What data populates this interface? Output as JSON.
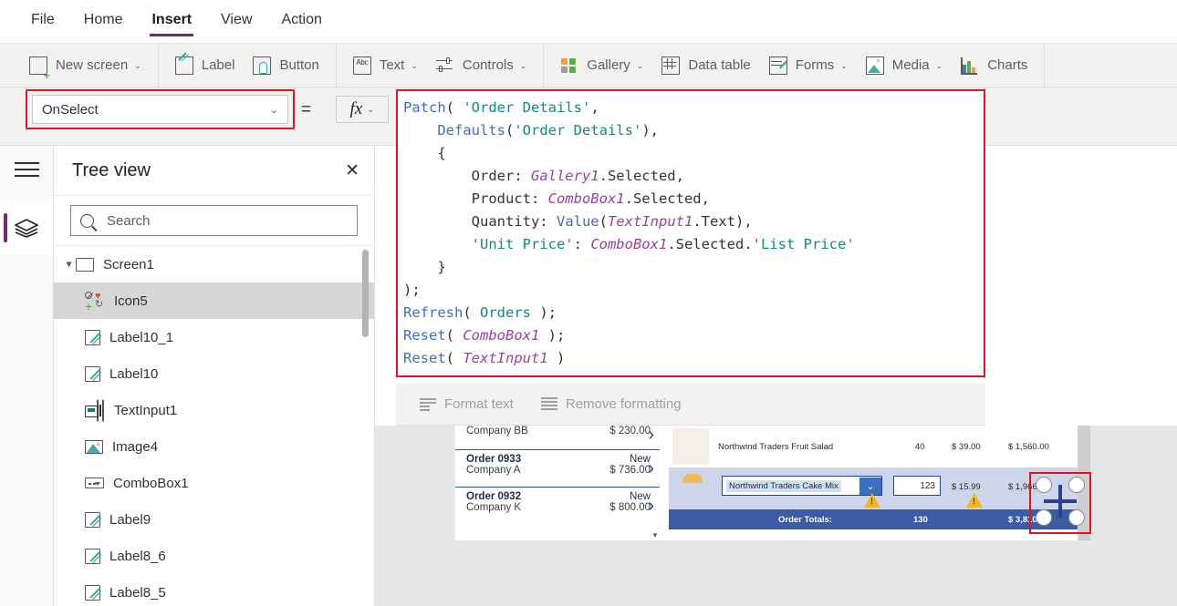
{
  "menu": {
    "items": [
      {
        "label": "File",
        "active": false
      },
      {
        "label": "Home",
        "active": false
      },
      {
        "label": "Insert",
        "active": true
      },
      {
        "label": "View",
        "active": false
      },
      {
        "label": "Action",
        "active": false
      }
    ]
  },
  "ribbon": {
    "groups": [
      {
        "buttons": [
          {
            "label": "New screen",
            "icon": "new-screen-icon",
            "chevron": true
          }
        ]
      },
      {
        "buttons": [
          {
            "label": "Label",
            "icon": "label-icon",
            "chevron": false
          },
          {
            "label": "Button",
            "icon": "button-icon",
            "chevron": false
          }
        ]
      },
      {
        "buttons": [
          {
            "label": "Text",
            "icon": "text-icon",
            "chevron": true
          },
          {
            "label": "Controls",
            "icon": "controls-icon",
            "chevron": true
          }
        ]
      },
      {
        "buttons": [
          {
            "label": "Gallery",
            "icon": "gallery-icon",
            "chevron": true
          },
          {
            "label": "Data table",
            "icon": "data-table-icon",
            "chevron": false
          },
          {
            "label": "Forms",
            "icon": "forms-icon",
            "chevron": true
          },
          {
            "label": "Media",
            "icon": "media-icon",
            "chevron": true
          },
          {
            "label": "Charts",
            "icon": "charts-icon",
            "chevron": false
          }
        ]
      }
    ],
    "text_icon_glyph": "Abc"
  },
  "property_bar": {
    "selected_property": "OnSelect",
    "dropdown_glyph": "⌄",
    "equals": "=",
    "fx_label": "fx",
    "fx_chevron": "⌄"
  },
  "formula": {
    "lines": [
      [
        {
          "t": "Patch",
          "c": "fn"
        },
        {
          "t": "( ",
          "c": "pun"
        },
        {
          "t": "'Order Details'",
          "c": "str"
        },
        {
          "t": ",",
          "c": "pun"
        }
      ],
      [
        {
          "t": "    ",
          "c": "pun"
        },
        {
          "t": "Defaults",
          "c": "fn"
        },
        {
          "t": "(",
          "c": "pun"
        },
        {
          "t": "'Order Details'",
          "c": "str"
        },
        {
          "t": "),",
          "c": "pun"
        }
      ],
      [
        {
          "t": "    {",
          "c": "pun"
        }
      ],
      [
        {
          "t": "        Order: ",
          "c": "pun"
        },
        {
          "t": "Gallery1",
          "c": "ctl"
        },
        {
          "t": ".Selected,",
          "c": "pun"
        }
      ],
      [
        {
          "t": "        Product: ",
          "c": "pun"
        },
        {
          "t": "ComboBox1",
          "c": "ctl"
        },
        {
          "t": ".Selected,",
          "c": "pun"
        }
      ],
      [
        {
          "t": "        Quantity: ",
          "c": "pun"
        },
        {
          "t": "Value",
          "c": "fn"
        },
        {
          "t": "(",
          "c": "pun"
        },
        {
          "t": "TextInput1",
          "c": "ctl"
        },
        {
          "t": ".Text),",
          "c": "pun"
        }
      ],
      [
        {
          "t": "        ",
          "c": "pun"
        },
        {
          "t": "'Unit Price'",
          "c": "str"
        },
        {
          "t": ": ",
          "c": "pun"
        },
        {
          "t": "ComboBox1",
          "c": "ctl"
        },
        {
          "t": ".Selected.",
          "c": "pun"
        },
        {
          "t": "'List Price'",
          "c": "str"
        }
      ],
      [
        {
          "t": "    }",
          "c": "pun"
        }
      ],
      [
        {
          "t": ");",
          "c": "pun"
        }
      ],
      [
        {
          "t": "Refresh",
          "c": "fn"
        },
        {
          "t": "( ",
          "c": "pun"
        },
        {
          "t": "Orders",
          "c": "str"
        },
        {
          "t": " );",
          "c": "pun"
        }
      ],
      [
        {
          "t": "Reset",
          "c": "fn"
        },
        {
          "t": "( ",
          "c": "pun"
        },
        {
          "t": "ComboBox1",
          "c": "ctl"
        },
        {
          "t": " );",
          "c": "pun"
        }
      ],
      [
        {
          "t": "Reset",
          "c": "fn"
        },
        {
          "t": "( ",
          "c": "pun"
        },
        {
          "t": "TextInput1",
          "c": "ctl"
        },
        {
          "t": " )",
          "c": "pun"
        }
      ]
    ]
  },
  "format_bar": {
    "format_text_label": "Format text",
    "remove_formatting_label": "Remove formatting"
  },
  "rail": {
    "hamburger": "hamburger-icon",
    "active_tool": "tree-view-layers-icon"
  },
  "tree_view": {
    "title": "Tree view",
    "close_glyph": "✕",
    "search_placeholder": "Search",
    "search_value": "",
    "items": [
      {
        "label": "Screen1",
        "icon": "screen-icon",
        "level": 0,
        "selected": false,
        "expanded": true
      },
      {
        "label": "Icon5",
        "icon": "icon5-icon",
        "level": 1,
        "selected": true,
        "expanded": false
      },
      {
        "label": "Label10_1",
        "icon": "label-icon",
        "level": 1,
        "selected": false,
        "expanded": false
      },
      {
        "label": "Label10",
        "icon": "label-icon",
        "level": 1,
        "selected": false,
        "expanded": false
      },
      {
        "label": "TextInput1",
        "icon": "text-input-icon",
        "level": 1,
        "selected": false,
        "expanded": false
      },
      {
        "label": "Image4",
        "icon": "image-icon",
        "level": 1,
        "selected": false,
        "expanded": false
      },
      {
        "label": "ComboBox1",
        "icon": "combobox-icon",
        "level": 1,
        "selected": false,
        "expanded": false
      },
      {
        "label": "Label9",
        "icon": "label-icon",
        "level": 1,
        "selected": false,
        "expanded": false
      },
      {
        "label": "Label8_6",
        "icon": "label-icon",
        "level": 1,
        "selected": false,
        "expanded": false
      },
      {
        "label": "Label8_5",
        "icon": "label-icon",
        "level": 1,
        "selected": false,
        "expanded": false
      }
    ]
  },
  "canvas": {
    "gallery": {
      "partial_top_row": {
        "company": "Company BB",
        "amount": "$ 230.00"
      },
      "items": [
        {
          "order": "Order 0933",
          "status": "New",
          "company": "Company A",
          "amount": "$ 736.00"
        },
        {
          "order": "Order 0932",
          "status": "New",
          "company": "Company K",
          "amount": "$ 800.00"
        }
      ],
      "chevron_glyph": "›"
    },
    "detail": {
      "rows": [
        {
          "product": "Northwind Traders Fruit Salad",
          "qty": "40",
          "price": "$ 39.00",
          "total": "$ 1,560.00",
          "thumb": "fruit-salad-thumb"
        }
      ],
      "edit_row": {
        "combobox_value": "Northwind Traders Cake Mix",
        "combobox_arrow": "⌄",
        "quantity_value": "123",
        "price": "$ 15.99",
        "total": "$ 1,966.77",
        "thumb": "cake-mix-thumb",
        "warning_glyph": "!"
      },
      "totals": {
        "label": "Order Totals:",
        "quantity": "130",
        "amount": "$ 3,810.00"
      }
    },
    "selected_control": {
      "icon": "add-plus-icon",
      "handles": 4
    }
  },
  "colors": {
    "accent_purple": "#742774",
    "selection_red": "#e81123",
    "formula_function": "#3f6fb5",
    "formula_string": "#128a7f",
    "formula_control": "#9b3fa0",
    "app_blue": "#3b5ba5",
    "warning_yellow": "#f0b429"
  }
}
